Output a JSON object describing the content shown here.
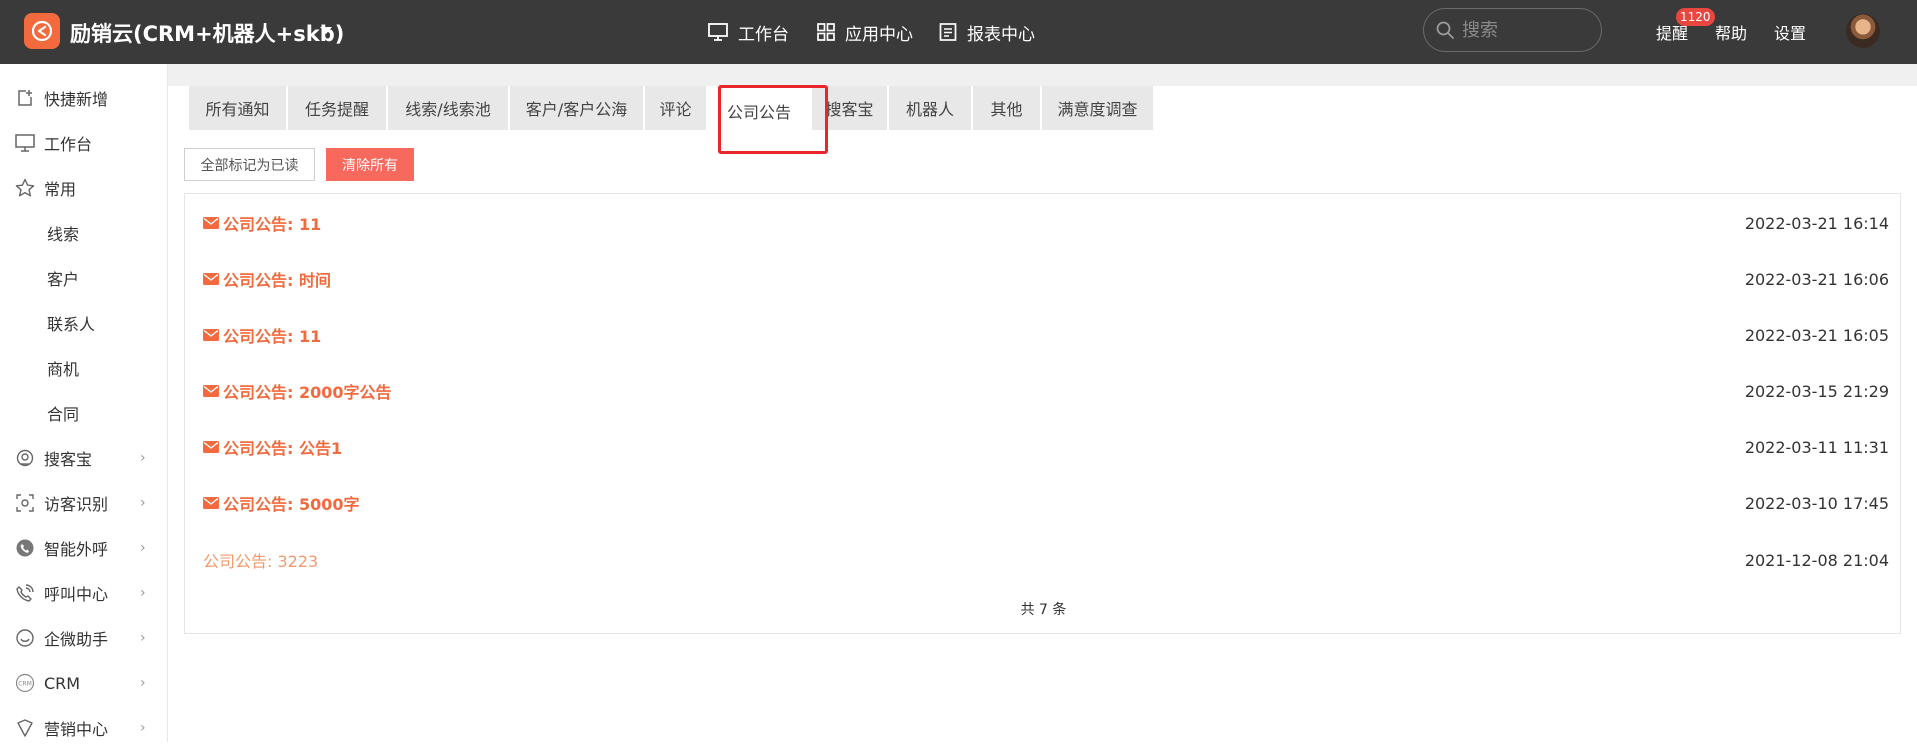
{
  "header": {
    "app_title": "励销云(CRM+机器人+skb)",
    "nav": [
      {
        "label": "工作台",
        "icon": "monitor-icon"
      },
      {
        "label": "应用中心",
        "icon": "grid-icon"
      },
      {
        "label": "报表中心",
        "icon": "report-icon"
      }
    ],
    "search_placeholder": "搜索",
    "remind_label": "提醒",
    "remind_badge": "1120",
    "help_label": "帮助",
    "settings_label": "设置"
  },
  "sidebar": {
    "items": [
      {
        "label": "快捷新增",
        "icon": "add-doc-icon"
      },
      {
        "label": "工作台",
        "icon": "monitor-icon"
      },
      {
        "label": "常用",
        "icon": "star-icon"
      },
      {
        "label": "线索"
      },
      {
        "label": "客户"
      },
      {
        "label": "联系人"
      },
      {
        "label": "商机"
      },
      {
        "label": "合同"
      },
      {
        "label": "搜客宝",
        "icon": "search-treasure-icon"
      },
      {
        "label": "访客识别",
        "icon": "visitor-icon"
      },
      {
        "label": "智能外呼",
        "icon": "phone-icon"
      },
      {
        "label": "呼叫中心",
        "icon": "call-center-icon"
      },
      {
        "label": "企微助手",
        "icon": "wecom-icon"
      },
      {
        "label": "CRM",
        "icon": "crm-icon"
      },
      {
        "label": "营销中心",
        "icon": "marketing-icon"
      }
    ]
  },
  "tabs": [
    {
      "label": "所有通知"
    },
    {
      "label": "任务提醒"
    },
    {
      "label": "线索/线索池"
    },
    {
      "label": "客户/客户公海"
    },
    {
      "label": "评论"
    },
    {
      "label": "公司公告",
      "active": true
    },
    {
      "label": "搜客宝"
    },
    {
      "label": "机器人"
    },
    {
      "label": "其他"
    },
    {
      "label": "满意度调查"
    }
  ],
  "actions": {
    "mark_all_read": "全部标记为已读",
    "clear_all": "清除所有"
  },
  "notices": [
    {
      "title": "公司公告: 11",
      "time": "2022-03-21 16:14",
      "unread": true
    },
    {
      "title": "公司公告: 时间",
      "time": "2022-03-21 16:06",
      "unread": true
    },
    {
      "title": "公司公告: 11",
      "time": "2022-03-21 16:05",
      "unread": true
    },
    {
      "title": "公司公告: 2000字公告",
      "time": "2022-03-15 21:29",
      "unread": true
    },
    {
      "title": "公司公告: 公告1",
      "time": "2022-03-11 11:31",
      "unread": true
    },
    {
      "title": "公司公告: 5000字",
      "time": "2022-03-10 17:45",
      "unread": true
    },
    {
      "title": "公司公告: 3223",
      "time": "2021-12-08 21:04",
      "unread": false
    }
  ],
  "total_text": "共 7 条",
  "colors": {
    "topbar": "#3a3a3a",
    "accent": "#f26a3d",
    "clear_button": "#f7695c",
    "highlight": "#e8262b"
  }
}
